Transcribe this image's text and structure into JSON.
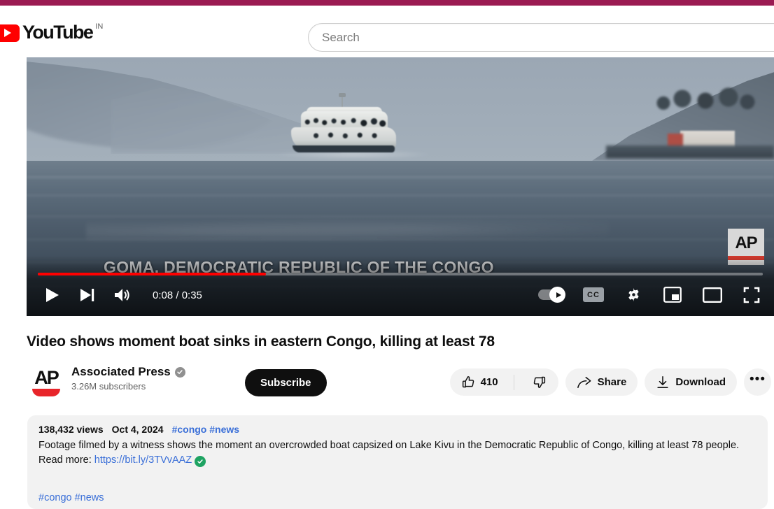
{
  "header": {
    "logo_word": "YouTube",
    "country_code": "IN",
    "search_placeholder": "Search",
    "search_value": ""
  },
  "player": {
    "caption_overlay": "GOMA, DEMOCRATIC REPUBLIC OF THE CONGO",
    "watermark_text": "AP",
    "current_time": "0:08",
    "duration": "0:35",
    "time_display": "0:08 / 0:35",
    "progress_percent": 31.5,
    "controls": {
      "play_label": "Play",
      "next_label": "Next",
      "volume_label": "Mute",
      "autoplay_label": "Autoplay",
      "captions_label": "CC",
      "settings_label": "Settings",
      "miniplayer_label": "Miniplayer",
      "theater_label": "Theater mode",
      "fullscreen_label": "Full screen"
    }
  },
  "video": {
    "title": "Video shows moment boat sinks in eastern Congo, killing at least 78"
  },
  "channel": {
    "avatar_text": "AP",
    "name": "Associated Press",
    "verified": true,
    "subscribers": "3.26M subscribers",
    "subscribe_label": "Subscribe"
  },
  "actions": {
    "like_count": "410",
    "share_label": "Share",
    "download_label": "Download",
    "more_label": "•••"
  },
  "description": {
    "views": "138,432 views",
    "date": "Oct 4, 2024",
    "meta_hashtags": "#congo #news",
    "body_line1": "Footage filmed by a witness shows the moment an overcrowded boat capsized on Lake Kivu in the Democratic Republic of Congo,",
    "body_line2_prefix": "killing at least 78 people. Read more: ",
    "body_link": "https://bit.ly/3TVvAAZ",
    "tags": "#congo #news"
  },
  "colors": {
    "accent_bar": "#9b1b52",
    "brand_red": "#ff0000",
    "progress_red": "#ff0000",
    "link_blue": "#3a6fd8",
    "verified_green": "#1ea362"
  }
}
